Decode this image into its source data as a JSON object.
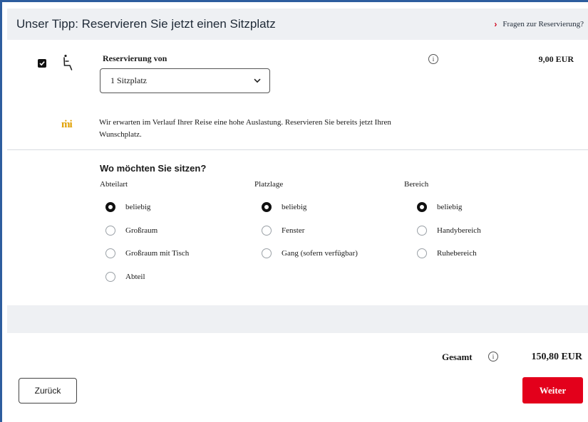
{
  "header": {
    "title": "Unser Tipp: Reservieren Sie jetzt einen Sitzplatz",
    "faq_link": "Fragen zur Reservierung?"
  },
  "reservation": {
    "checked": true,
    "label": "Reservierung von",
    "select_value": "1 Sitzplatz",
    "price": "9,00 EUR",
    "notice": "Wir erwarten im Verlauf Ihrer Reise eine hohe Auslastung. Reservieren Sie bereits jetzt Ihren Wunschplatz."
  },
  "seating": {
    "question": "Wo möchten Sie sitzen?",
    "columns": [
      {
        "heading": "Abteilart",
        "options": [
          {
            "label": "beliebig",
            "selected": true
          },
          {
            "label": "Großraum",
            "selected": false
          },
          {
            "label": "Großraum mit Tisch",
            "selected": false
          },
          {
            "label": "Abteil",
            "selected": false
          }
        ]
      },
      {
        "heading": "Platzlage",
        "options": [
          {
            "label": "beliebig",
            "selected": true
          },
          {
            "label": "Fenster",
            "selected": false
          },
          {
            "label": "Gang (sofern verfügbar)",
            "selected": false
          }
        ]
      },
      {
        "heading": "Bereich",
        "options": [
          {
            "label": "beliebig",
            "selected": true
          },
          {
            "label": "Handybereich",
            "selected": false
          },
          {
            "label": "Ruhebereich",
            "selected": false
          }
        ]
      }
    ]
  },
  "footer": {
    "total_label": "Gesamt",
    "total_value": "150,80 EUR",
    "back_label": "Zurück",
    "next_label": "Weiter"
  },
  "icons": {
    "info": "i",
    "faq_chevron": "›"
  },
  "colors": {
    "accent": "#e3001b",
    "frame": "#2d5d9e",
    "warning": "#e0a000"
  }
}
